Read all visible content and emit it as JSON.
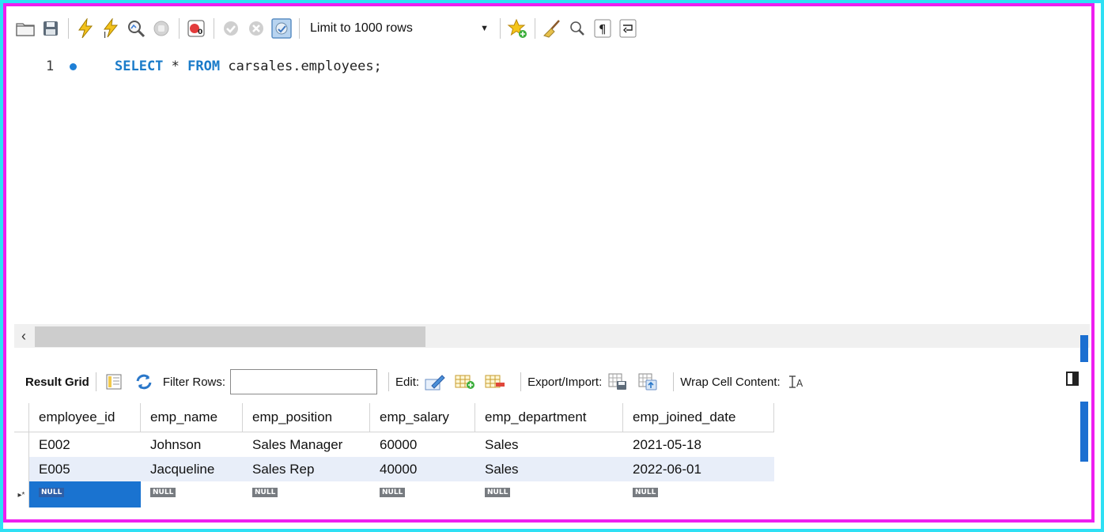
{
  "toolbar": {
    "limit_label": "Limit to 1000 rows",
    "icons": [
      "open-folder",
      "save",
      "execute",
      "execute-current",
      "explain",
      "stop",
      "toggle-autocommit",
      "commit",
      "rollback",
      "toggle-continue-on-error",
      "add-snippet",
      "beautify",
      "find",
      "invisible-chars",
      "word-wrap"
    ]
  },
  "editor": {
    "line_number": "1",
    "kw_select": "SELECT",
    "star": " * ",
    "kw_from": "FROM",
    "rest": " carsales.employees;"
  },
  "results_toolbar": {
    "result_grid": "Result Grid",
    "filter_rows": "Filter Rows:",
    "filter_value": "",
    "edit": "Edit:",
    "export_import": "Export/Import:",
    "wrap_cell_content": "Wrap Cell Content:"
  },
  "grid": {
    "columns": [
      "employee_id",
      "emp_name",
      "emp_position",
      "emp_salary",
      "emp_department",
      "emp_joined_date"
    ],
    "rows": [
      [
        "E002",
        "Johnson",
        "Sales Manager",
        "60000",
        "Sales",
        "2021-05-18"
      ],
      [
        "E005",
        "Jacqueline",
        "Sales Rep",
        "40000",
        "Sales",
        "2022-06-01"
      ]
    ],
    "null_label": "NULL",
    "new_row_marker": "▸*"
  },
  "colors": {
    "frame_outer": "#2ee0f4",
    "frame_inner": "#ee1ef0",
    "keyword": "#1a7bc9",
    "selection": "#1a73d0"
  }
}
